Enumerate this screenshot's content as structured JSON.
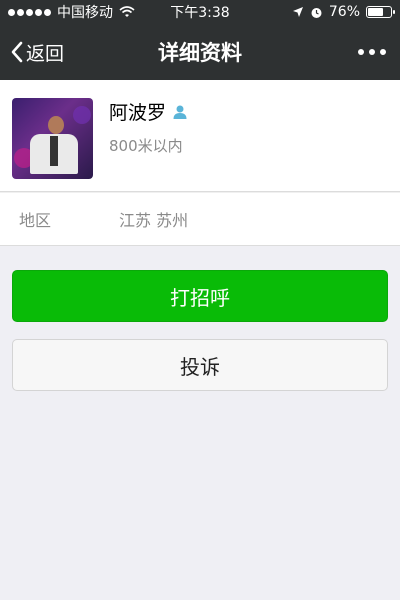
{
  "status_bar": {
    "carrier": "中国移动",
    "time": "下午3:38",
    "battery_percent": "76%",
    "battery_level": 0.76,
    "icons": [
      "signal-dots-icon",
      "wifi-icon",
      "location-arrow-icon",
      "alarm-clock-icon",
      "battery-icon"
    ]
  },
  "nav": {
    "back_label": "返回",
    "title": "详细资料",
    "more_icon": "more-dots-icon"
  },
  "profile": {
    "name": "阿波罗",
    "distance": "800米以内",
    "gender_icon": "male-user-icon",
    "gender_color": "#5ab4d8"
  },
  "details": {
    "region_label": "地区",
    "region_value": "江苏  苏州"
  },
  "actions": {
    "greet_label": "打招呼",
    "report_label": "投诉"
  },
  "colors": {
    "bar_bg": "#2e3132",
    "page_bg": "#efeff4",
    "green_button": "#09bb07"
  }
}
